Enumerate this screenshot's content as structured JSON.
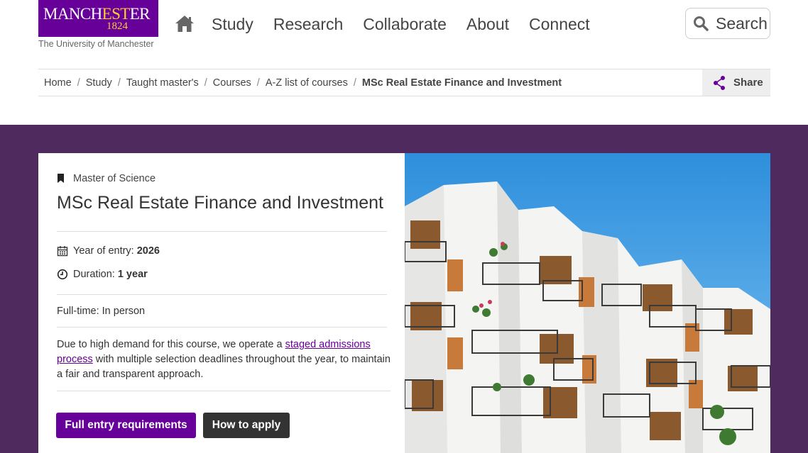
{
  "header": {
    "logo": {
      "wordmark_pre": "MANCH",
      "wordmark_est": "EST",
      "wordmark_post": "ER",
      "year": "1824",
      "subtitle": "The University of Manchester"
    },
    "home_icon": "home-icon",
    "nav": [
      "Study",
      "Research",
      "Collaborate",
      "About",
      "Connect"
    ],
    "search_label": "Search"
  },
  "breadcrumb": {
    "items": [
      "Home",
      "Study",
      "Taught master's",
      "Courses",
      "A-Z list of courses"
    ],
    "current": "MSc Real Estate Finance and Investment",
    "share_label": "Share"
  },
  "course": {
    "degree_type": "Master of Science",
    "title": "MSc Real Estate Finance and Investment",
    "year_label": "Year of entry:",
    "year_value": "2026",
    "duration_label": "Duration:",
    "duration_value": "1 year",
    "mode": "Full-time: In person",
    "notice_pre": "Due to high demand for this course, we operate a ",
    "notice_link": "staged admissions process",
    "notice_post": " with multiple selection deadlines throughout the year, to maintain a fair and transparent approach.",
    "btn_requirements": "Full entry requirements",
    "btn_apply": "How to apply"
  },
  "colors": {
    "brand_purple": "#660099",
    "hero_bg": "#4f2a5e",
    "logo_gold": "#ffcc33"
  }
}
